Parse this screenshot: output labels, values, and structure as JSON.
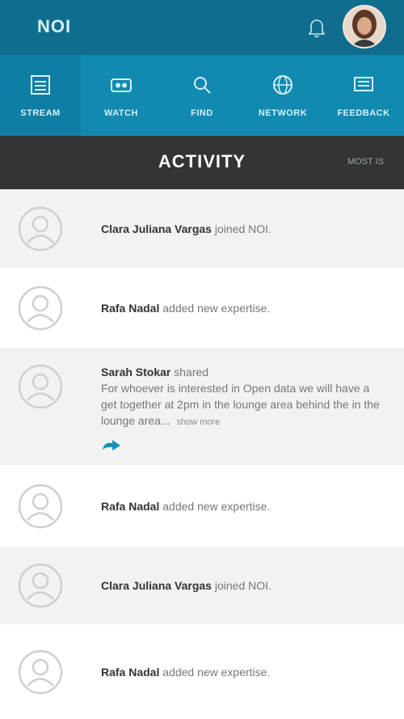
{
  "app": {
    "logo": "NOI"
  },
  "nav": {
    "items": [
      {
        "label": "STREAM",
        "icon": "stream-icon",
        "active": true
      },
      {
        "label": "WATCH",
        "icon": "watch-icon",
        "active": false
      },
      {
        "label": "FIND",
        "icon": "search-icon",
        "active": false
      },
      {
        "label": "NETWORK",
        "icon": "globe-icon",
        "active": false
      },
      {
        "label": "FEEDBACK",
        "icon": "feedback-icon",
        "active": false
      }
    ]
  },
  "section": {
    "title": "ACTIVITY",
    "action": "MOST IS"
  },
  "feed": {
    "items": [
      {
        "name": "Clara Juliana Vargas",
        "action": "joined NOI.",
        "shade": "grey"
      },
      {
        "name": "Rafa Nadal",
        "action": "added new expertise.",
        "shade": "white"
      },
      {
        "name": "Sarah Stokar",
        "action": "shared",
        "body": "For whoever is interested in Open data we will have a get together at 2pm in the lounge area behind the in the lounge area...",
        "more": "show more",
        "shade": "grey"
      },
      {
        "name": "Rafa Nadal",
        "action": "added new expertise.",
        "shade": "white"
      },
      {
        "name": "Clara Juliana Vargas",
        "action": "joined NOI.",
        "shade": "grey"
      },
      {
        "name": "Rafa Nadal",
        "action": "added new expertise.",
        "shade": "white"
      }
    ]
  },
  "colors": {
    "topbar": "#0f6e8e",
    "nav": "#1289b0",
    "section": "#343434",
    "accent": "#1a8fb8"
  }
}
